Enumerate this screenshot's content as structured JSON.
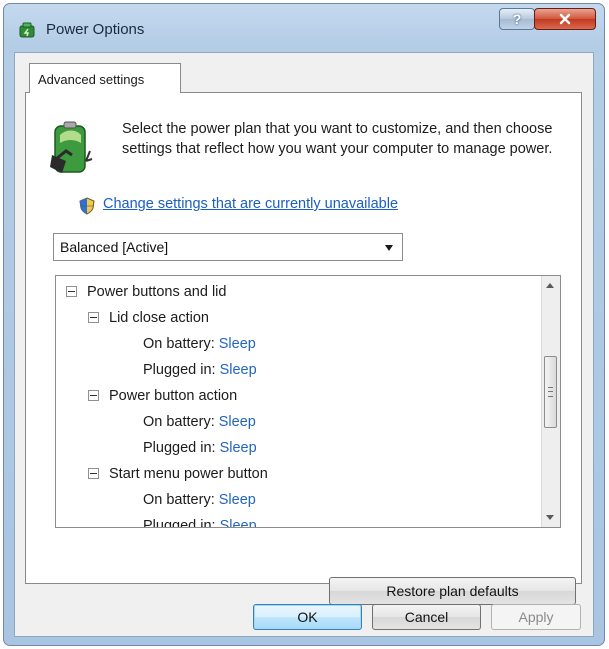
{
  "window": {
    "title": "Power Options",
    "help_glyph": "?",
    "help_button_icon": "help-icon",
    "close_button_icon": "close-icon"
  },
  "tab": {
    "label": "Advanced settings"
  },
  "description": "Select the power plan that you want to customize, and then choose settings that reflect how you want your computer to manage power.",
  "change_settings_link": "Change settings that are currently unavailable",
  "plan_selector": {
    "value": "Balanced [Active]"
  },
  "tree": [
    {
      "label": "Power buttons and lid",
      "value": ""
    },
    {
      "label": "Lid close action",
      "value": ""
    },
    {
      "label": "On battery:",
      "value": "Sleep"
    },
    {
      "label": "Plugged in:",
      "value": "Sleep"
    },
    {
      "label": "Power button action",
      "value": ""
    },
    {
      "label": "On battery:",
      "value": "Sleep"
    },
    {
      "label": "Plugged in:",
      "value": "Sleep"
    },
    {
      "label": "Start menu power button",
      "value": ""
    },
    {
      "label": "On battery:",
      "value": "Sleep"
    },
    {
      "label": "Plugged in:",
      "value": "Sleep"
    }
  ],
  "buttons": {
    "restore": "Restore plan defaults",
    "ok": "OK",
    "cancel": "Cancel",
    "apply": "Apply"
  },
  "colors": {
    "link": "#1a5ec3",
    "value": "#2365c0",
    "ok_border": "#3c7fb1",
    "close_red": "#c23a20"
  }
}
